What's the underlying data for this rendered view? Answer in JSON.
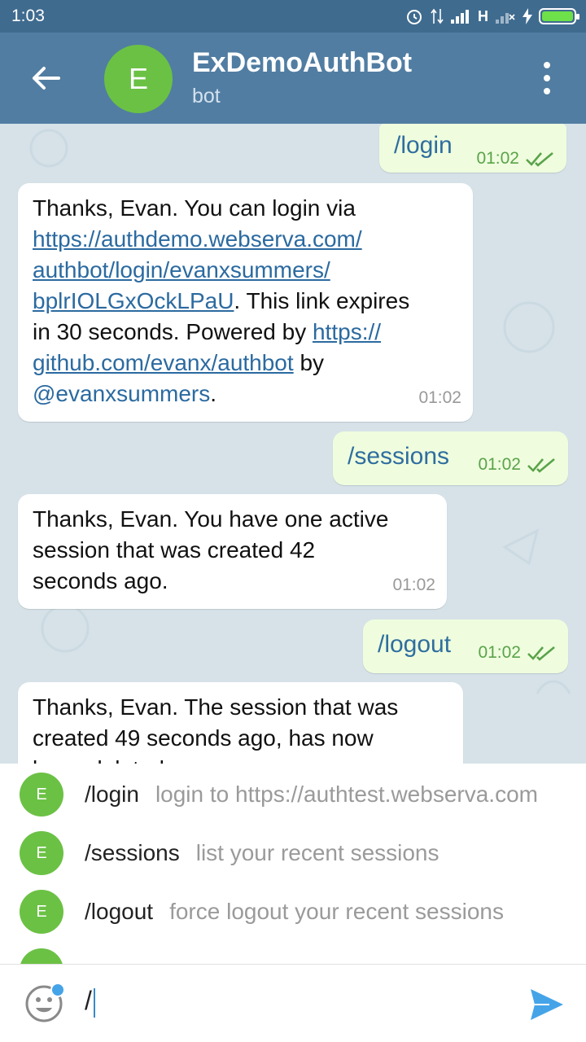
{
  "status_bar": {
    "time": "1:03",
    "network": "H"
  },
  "header": {
    "avatar_letter": "E",
    "title": "ExDemoAuthBot",
    "subtitle": "bot"
  },
  "messages": [
    {
      "dir": "out",
      "text": "/login",
      "time": "01:02"
    },
    {
      "dir": "in",
      "line1": "Thanks, Evan. You can login via",
      "link1a": "https://authdemo.webserva.com/",
      "link1b": "authbot/login/evanxsummers/",
      "link1c": "bplrIOLGxOckLPaU",
      "text2": ". This link expires",
      "text3": "in 30 seconds. Powered by ",
      "link2a": "https://",
      "link2b": "github.com/evanx/authbot",
      "text4": " by",
      "mention": "@evanxsummers",
      "text5": ".",
      "time": "01:02"
    },
    {
      "dir": "out",
      "text": "/sessions",
      "time": "01:02"
    },
    {
      "dir": "in",
      "line1": "Thanks, Evan. You have one active",
      "line2": "session that was created 42",
      "line3": "seconds ago.",
      "time": "01:02"
    },
    {
      "dir": "out",
      "text": "/logout",
      "time": "01:02"
    },
    {
      "dir": "in",
      "line1": "Thanks, Evan. The session that was",
      "line2": "created 49 seconds ago, has now",
      "line3": "been deleted."
    }
  ],
  "commands": [
    {
      "avatar": "E",
      "name": "/login",
      "desc": "login to https://authtest.webserva.com"
    },
    {
      "avatar": "E",
      "name": "/sessions",
      "desc": "list your recent sessions"
    },
    {
      "avatar": "E",
      "name": "/logout",
      "desc": "force logout your recent sessions"
    },
    {
      "avatar": "E",
      "name": "",
      "desc": ""
    }
  ],
  "input": {
    "value": "/"
  },
  "colors": {
    "header": "#517da2",
    "status_bar": "#3f6b8f",
    "avatar": "#6bc144",
    "outgoing_bubble": "#effdde",
    "link": "#2b6aa0"
  }
}
